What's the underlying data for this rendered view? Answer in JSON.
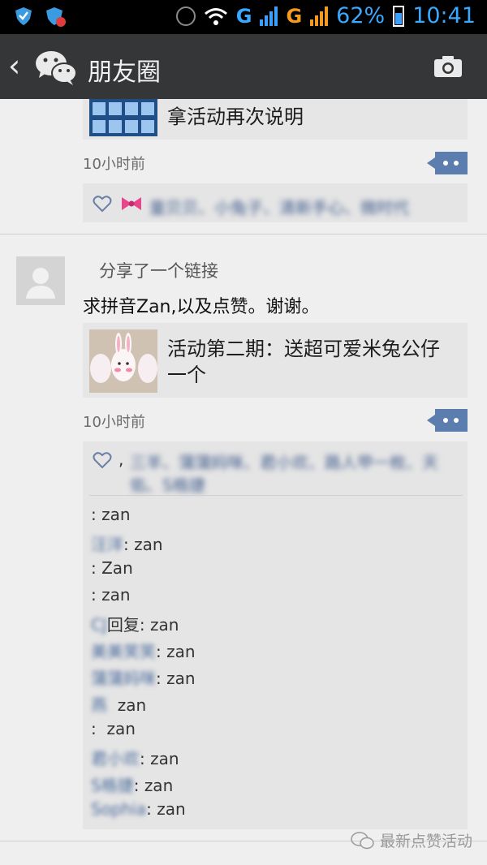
{
  "status_bar": {
    "network_1": "G",
    "network_2": "G",
    "battery": "62%",
    "time": "10:41",
    "icons": [
      "shield-icon",
      "shield-badge-icon",
      "alarm-icon",
      "wifi-icon",
      "signal-icon",
      "battery-icon"
    ]
  },
  "header": {
    "title": "朋友圈",
    "icons": [
      "back-icon",
      "wechat-logo-icon",
      "camera-icon"
    ]
  },
  "post_prev": {
    "link_title": "拿活动再次说明",
    "time": "10小时前",
    "likers": "童贝贝、小兔子、清新手心、微时代"
  },
  "post_main": {
    "share_label": "分享了一个链接",
    "text": "求拼音Zan,以及点赞。谢谢。",
    "link_title": "活动第二期：送超可爱米兔公仔一个",
    "time": "10小时前",
    "likers_prefix": ",",
    "likers": "三羊、蒲蒲妈咪、君小欢、路人甲一枚、天佑、S格捷",
    "comments": [
      {
        "name": "",
        "sep": ": ",
        "text": "zan"
      },
      {
        "name": "汪洋",
        "sep": ": ",
        "text": "zan"
      },
      {
        "name": "",
        "sep": ": ",
        "text": "Zan"
      },
      {
        "name": "",
        "sep": ": ",
        "text": "zan"
      },
      {
        "name": "CJ",
        "sep": "回复: ",
        "text": "zan"
      },
      {
        "name": "美美笑笑",
        "sep": ": ",
        "text": "zan"
      },
      {
        "name": "蒲蒲妈咪",
        "sep": ": ",
        "text": "zan"
      },
      {
        "name": "燕",
        "sep": "  ",
        "text": "zan"
      },
      {
        "name": "",
        "sep": ":  ",
        "text": "zan"
      },
      {
        "name": "君小欢",
        "sep": ": ",
        "text": "zan"
      },
      {
        "name": "S格捷",
        "sep": ": ",
        "text": "zan"
      },
      {
        "name": "Sophia",
        "sep": ": ",
        "text": "zan"
      }
    ]
  },
  "watermark": {
    "text": "最新点赞活动"
  },
  "colors": {
    "titlebar": "#343638",
    "background": "#efeff0",
    "comment_button": "#5b7eae",
    "name_link": "#4a6a9c"
  }
}
